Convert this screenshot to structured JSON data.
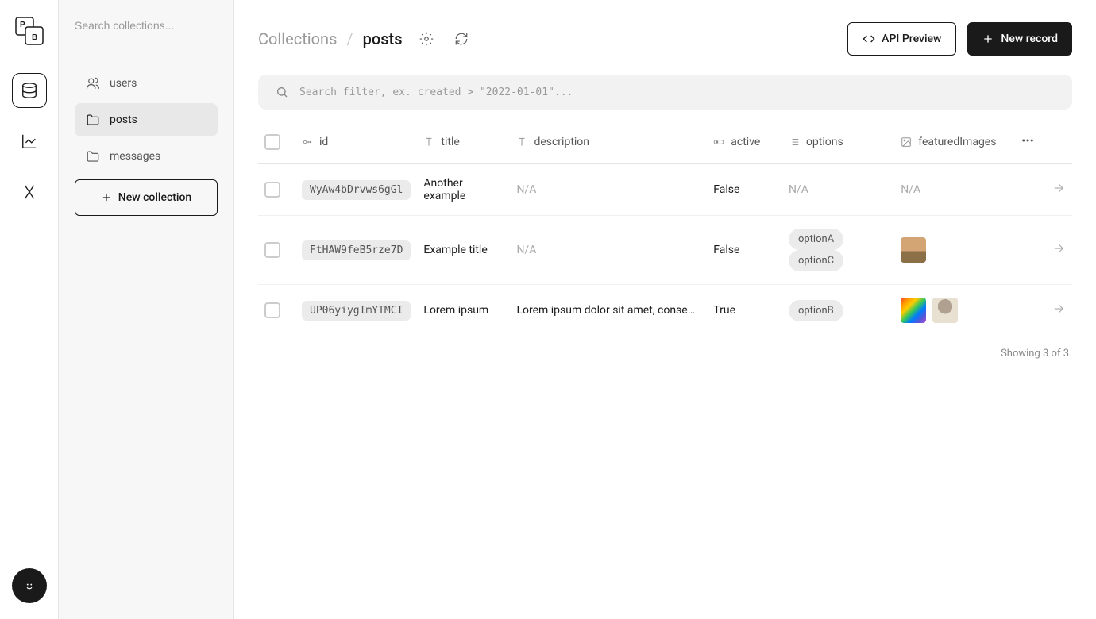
{
  "sidebar": {
    "search_placeholder": "Search collections...",
    "items": [
      {
        "label": "users"
      },
      {
        "label": "posts"
      },
      {
        "label": "messages"
      }
    ],
    "new_collection_label": "New collection"
  },
  "header": {
    "breadcrumb_root": "Collections",
    "breadcrumb_current": "posts",
    "api_preview_label": "API Preview",
    "new_record_label": "New record"
  },
  "filter": {
    "placeholder": "Search filter, ex. created > \"2022-01-01\"..."
  },
  "columns": {
    "id": "id",
    "title": "title",
    "description": "description",
    "active": "active",
    "options": "options",
    "featuredImages": "featuredImages"
  },
  "rows": [
    {
      "id": "WyAw4bDrvws6gGl",
      "title": "Another example",
      "description": "N/A",
      "active": "False",
      "options": [],
      "options_na": "N/A",
      "images": [],
      "images_na": "N/A"
    },
    {
      "id": "FtHAW9feB5rze7D",
      "title": "Example title",
      "description": "N/A",
      "active": "False",
      "options": [
        "optionA",
        "optionC"
      ],
      "images": [
        "sunset"
      ]
    },
    {
      "id": "UP06yiygImYTMCI",
      "title": "Lorem ipsum",
      "description": "Lorem ipsum dolor sit amet, consectetur adipiscing",
      "active": "True",
      "options": [
        "optionB"
      ],
      "images": [
        "rainbow",
        "cat"
      ]
    }
  ],
  "footer": {
    "showing": "Showing 3 of 3"
  }
}
